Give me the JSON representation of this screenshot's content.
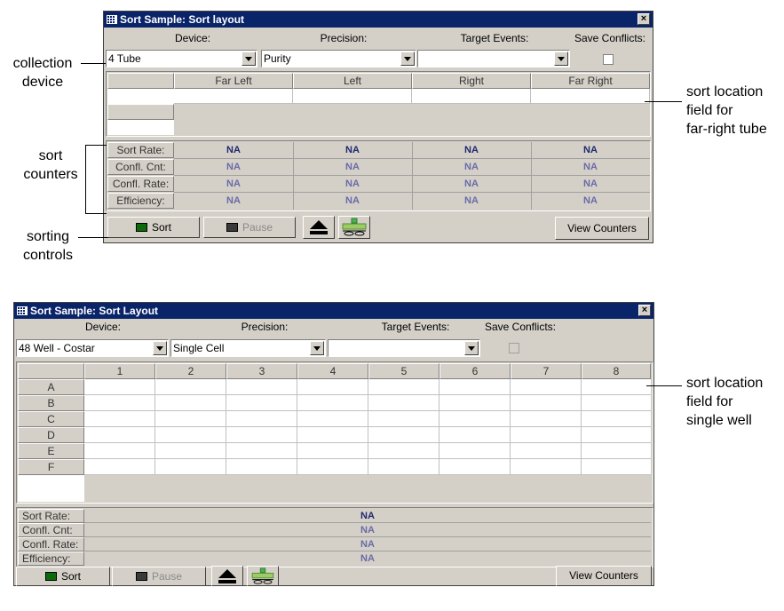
{
  "window1": {
    "title": "Sort Sample: Sort layout",
    "labels": {
      "device": "Device:",
      "precision": "Precision:",
      "target_events": "Target Events:",
      "save_conflicts": "Save Conflicts:"
    },
    "device_value": "4 Tube",
    "precision_value": "Purity",
    "target_events_value": "",
    "save_conflicts_checked": false,
    "columns": [
      "Far Left",
      "Left",
      "Right",
      "Far Right"
    ],
    "counter_labels": [
      "Sort Rate:",
      "Confl. Cnt:",
      "Confl. Rate:",
      "Efficiency:"
    ],
    "counter_values": [
      [
        "NA",
        "NA",
        "NA",
        "NA"
      ],
      [
        "NA",
        "NA",
        "NA",
        "NA"
      ],
      [
        "NA",
        "NA",
        "NA",
        "NA"
      ],
      [
        "NA",
        "NA",
        "NA",
        "NA"
      ]
    ],
    "buttons": {
      "sort": "Sort",
      "pause": "Pause",
      "view_counters": "View Counters"
    }
  },
  "window2": {
    "title": "Sort Sample: Sort Layout",
    "labels": {
      "device": "Device:",
      "precision": "Precision:",
      "target_events": "Target Events:",
      "save_conflicts": "Save Conflicts:"
    },
    "device_value": "48 Well - Costar",
    "precision_value": "Single Cell",
    "target_events_value": "",
    "save_conflicts_checked": false,
    "columns": [
      "1",
      "2",
      "3",
      "4",
      "5",
      "6",
      "7",
      "8"
    ],
    "rows": [
      "A",
      "B",
      "C",
      "D",
      "E",
      "F"
    ],
    "counter_labels": [
      "Sort Rate:",
      "Confl. Cnt:",
      "Confl. Rate:",
      "Efficiency:"
    ],
    "counter_values": [
      "NA",
      "NA",
      "NA",
      "NA"
    ],
    "buttons": {
      "sort": "Sort",
      "pause": "Pause",
      "view_counters": "View Counters"
    }
  },
  "annotations": {
    "collection_device": [
      "collection",
      "device"
    ],
    "sort_counters": [
      "sort",
      "counters"
    ],
    "sorting_controls": [
      "sorting",
      "controls"
    ],
    "sort_location_tube": [
      "sort location",
      "field for",
      "far-right tube"
    ],
    "sort_location_well": [
      "sort location",
      "field for",
      "single well"
    ]
  }
}
